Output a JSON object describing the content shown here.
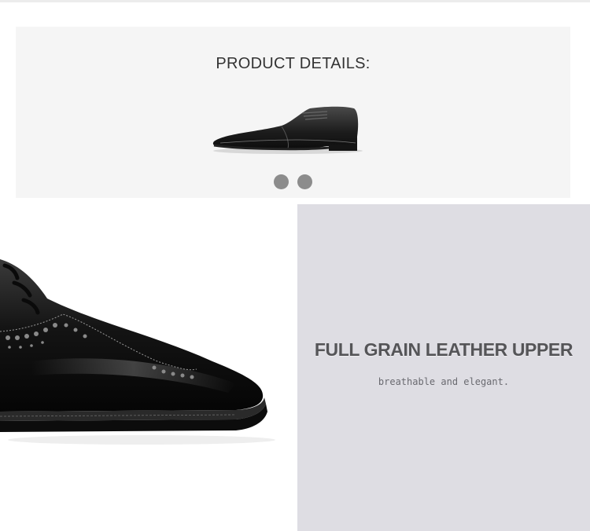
{
  "details": {
    "title": "PRODUCT DETAILS:",
    "carousel_dots": 2,
    "dot_color": "#8c8c8c",
    "panel_color": "#f5f5f5"
  },
  "feature": {
    "title": "FULL GRAIN LEATHER UPPER",
    "subtitle": "breathable and elegant.",
    "panel_color": "#dedde3"
  },
  "images": {
    "small_shoe": "black-cap-toe-oxford-shoe",
    "large_shoe": "black-brogue-wingtip-shoe-closeup"
  }
}
